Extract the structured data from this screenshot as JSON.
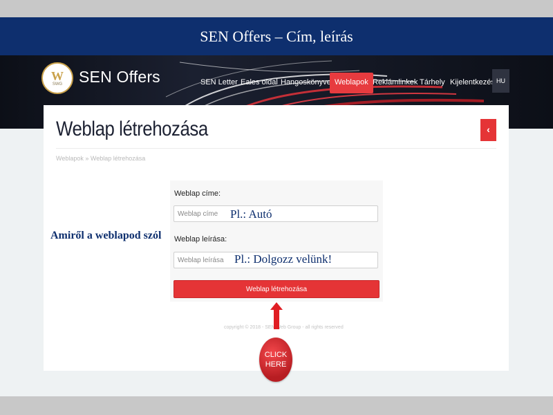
{
  "slide": {
    "title": "SEN Offers –  Cím, leírás"
  },
  "header": {
    "logo_text": "W",
    "logo_subtext": "SWG",
    "brand": "SEN Offers",
    "nav": [
      {
        "label": "SEN Letter"
      },
      {
        "label": "Eales oldal"
      },
      {
        "label": "Hangoskönyvek"
      },
      {
        "label": "Weblapok",
        "active": true
      },
      {
        "label": "Reklámlinkek"
      },
      {
        "label": "Tárhely"
      },
      {
        "label": "Kijelentkezés"
      }
    ],
    "language": "HU"
  },
  "page": {
    "title": "Weblap létrehozása",
    "back_icon": "‹",
    "breadcrumb": "Weblapok » Weblap létrehozása"
  },
  "form": {
    "title_label": "Weblap címe:",
    "title_placeholder": "Weblap címe",
    "desc_label": "Weblap leírása:",
    "desc_placeholder": "Weblap leírása",
    "submit": "Weblap létrehozása"
  },
  "annotations": {
    "left_note": "Amiről  a weblapod szól",
    "title_hint": "Pl.: Autó",
    "desc_hint": "Pl.: Dolgozz velünk!",
    "click_line1": "CLICK",
    "click_line2": "HERE"
  },
  "footer": {
    "copyright": "copyright © 2018 - SEN Web Group - all rights reserved"
  },
  "colors": {
    "title_bar": "#0e2f6e",
    "accent_red": "#e53436",
    "hero_bg": "#0c0f17"
  }
}
